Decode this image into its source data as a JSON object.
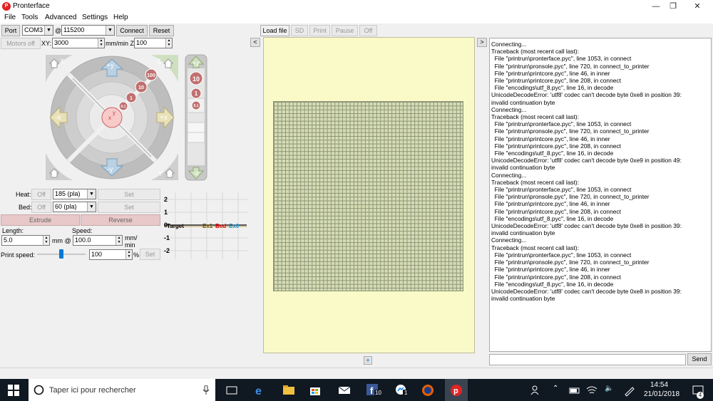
{
  "window": {
    "title": "Pronterface",
    "controls": [
      "—",
      "❐",
      "✕"
    ]
  },
  "menu": [
    "File",
    "Tools",
    "Advanced",
    "Settings",
    "Help"
  ],
  "connection": {
    "port_label": "Port",
    "port_value": "COM3",
    "at": "@",
    "baud_value": "115200",
    "connect_label": "Connect",
    "reset_label": "Reset"
  },
  "motion": {
    "motors_off": "Motors off",
    "xy_label": "XY:",
    "xy_speed": "3000",
    "z_label": "mm/min Z:",
    "z_speed": "100"
  },
  "jog": {
    "home_x": "X",
    "home_z": "Z",
    "home_y": "Y",
    "plus_y": "+y",
    "minus_y": "-y",
    "minus_x": "-x",
    "plus_x": "+x",
    "steps": [
      "100",
      "10",
      "1",
      "0.1"
    ],
    "center_x": "x",
    "center_y": "y",
    "plus_z": "+z",
    "minus_z": "-z",
    "z_steps": [
      "10",
      "1",
      "0.1"
    ]
  },
  "temps": {
    "heat_label": "Heat:",
    "heat_off": "Off",
    "heat_value": "185 (pla)",
    "heat_set": "Set",
    "bed_label": "Bed:",
    "bed_off": "Off",
    "bed_value": "60 (pla)",
    "bed_set": "Set"
  },
  "graph": {
    "y_ticks": [
      "2",
      "1",
      "0",
      "-1",
      "-2"
    ],
    "legend_target": "Target",
    "legend_ex1": "Ex1",
    "legend_bed": "Bed",
    "legend_ex0": "Ex0",
    "colors": {
      "target": "#000000",
      "ex1": "#7a5a00",
      "bed": "#e00000",
      "ex0": "#1e9be0"
    }
  },
  "extrude": {
    "extrude_label": "Extrude",
    "reverse_label": "Reverse",
    "length_label": "Length:",
    "length_value": "5.0",
    "mm_at": "mm @",
    "speed_label": "Speed:",
    "speed_value": "100.0",
    "speed_unit_1": "mm/",
    "speed_unit_2": "min"
  },
  "print_speed": {
    "label": "Print speed:",
    "value": "100",
    "unit": "%",
    "set_label": "Set",
    "slider_fraction": 0.5
  },
  "toolbar": {
    "load_file": "Load file",
    "sd": "SD",
    "print": "Print",
    "pause": "Pause",
    "off": "Off",
    "collapse_left": "<",
    "collapse_right": ">",
    "add": "+"
  },
  "console_lines": [
    "Connecting...",
    "Traceback (most recent call last):",
    "  File \"printrun\\pronterface.pyc\", line 1053, in connect",
    "  File \"printrun\\pronsole.pyc\", line 720, in connect_to_printer",
    "  File \"printrun\\printcore.pyc\", line 46, in inner",
    "  File \"printrun\\printcore.pyc\", line 208, in connect",
    "  File \"encodings\\utf_8.pyc\", line 16, in decode",
    "UnicodeDecodeError: 'utf8' codec can't decode byte 0xe8 in position 39:",
    "invalid continuation byte",
    "Connecting...",
    "Traceback (most recent call last):",
    "  File \"printrun\\pronterface.pyc\", line 1053, in connect",
    "  File \"printrun\\pronsole.pyc\", line 720, in connect_to_printer",
    "  File \"printrun\\printcore.pyc\", line 46, in inner",
    "  File \"printrun\\printcore.pyc\", line 208, in connect",
    "  File \"encodings\\utf_8.pyc\", line 16, in decode",
    "UnicodeDecodeError: 'utf8' codec can't decode byte 0xe9 in position 49:",
    "invalid continuation byte",
    "Connecting...",
    "Traceback (most recent call last):",
    "  File \"printrun\\pronterface.pyc\", line 1053, in connect",
    "  File \"printrun\\pronsole.pyc\", line 720, in connect_to_printer",
    "  File \"printrun\\printcore.pyc\", line 46, in inner",
    "  File \"printrun\\printcore.pyc\", line 208, in connect",
    "  File \"encodings\\utf_8.pyc\", line 16, in decode",
    "UnicodeDecodeError: 'utf8' codec can't decode byte 0xe8 in position 39:",
    "invalid continuation byte",
    "Connecting...",
    "Traceback (most recent call last):",
    "  File \"printrun\\pronterface.pyc\", line 1053, in connect",
    "  File \"printrun\\pronsole.pyc\", line 720, in connect_to_printer",
    "  File \"printrun\\printcore.pyc\", line 46, in inner",
    "  File \"printrun\\printcore.pyc\", line 208, in connect",
    "  File \"encodings\\utf_8.pyc\", line 16, in decode",
    "UnicodeDecodeError: 'utf8' codec can't decode byte 0xe8 in position 39:",
    "invalid continuation byte"
  ],
  "send_label": "Send",
  "taskbar": {
    "search_placeholder": "Taper ici pour rechercher",
    "fb_badge": "10",
    "msg_badge": "1",
    "time": "14:54",
    "date": "21/01/2018",
    "notif_count": "4"
  }
}
